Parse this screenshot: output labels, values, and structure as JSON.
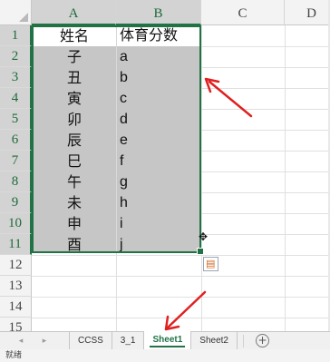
{
  "columns": [
    "A",
    "B",
    "C",
    "D"
  ],
  "rows": [
    "1",
    "2",
    "3",
    "4",
    "5",
    "6",
    "7",
    "8",
    "9",
    "10",
    "11",
    "12",
    "13",
    "14",
    "15"
  ],
  "cells": [
    {
      "a": "姓名",
      "b": "体育分数"
    },
    {
      "a": "子",
      "b": "a"
    },
    {
      "a": "丑",
      "b": "b"
    },
    {
      "a": "寅",
      "b": "c"
    },
    {
      "a": "卯",
      "b": "d"
    },
    {
      "a": "辰",
      "b": "e"
    },
    {
      "a": "巳",
      "b": "f"
    },
    {
      "a": "午",
      "b": "g"
    },
    {
      "a": "未",
      "b": "h"
    },
    {
      "a": "申",
      "b": "i"
    },
    {
      "a": "酉",
      "b": "j"
    }
  ],
  "sheet_tabs": [
    {
      "label": "CCSS",
      "active": false
    },
    {
      "label": "3_1",
      "active": false
    },
    {
      "label": "Sheet1",
      "active": true
    },
    {
      "label": "Sheet2",
      "active": false
    }
  ],
  "nav": {
    "prev_icon": "◂",
    "next_icon": "▸",
    "add_sheet": "+"
  },
  "status": {
    "text": "就绪"
  },
  "icons": {
    "quick_analysis": "quick-analysis-icon",
    "fill_handle_cursor": "plus-cursor-icon"
  },
  "colors": {
    "accent": "#217346",
    "selection_fill": "#c6c6c6",
    "annotation_arrow": "#e02020"
  }
}
